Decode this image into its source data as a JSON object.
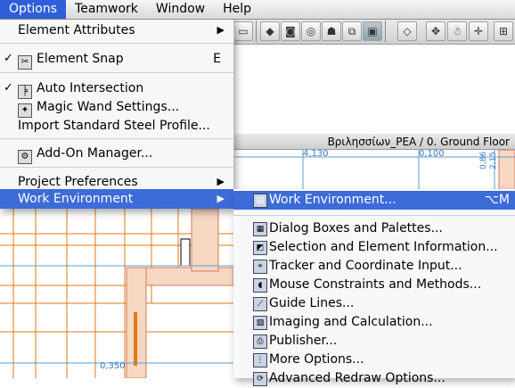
{
  "menubar": {
    "items": [
      "Options",
      "Teamwork",
      "Window",
      "Help"
    ],
    "active_index": 0
  },
  "window": {
    "title": "Βριλησσίων_PEA / 0. Ground Floor"
  },
  "plan": {
    "dimensions": [
      "4,130",
      "0,100",
      "0,350",
      "0,86",
      "2,15"
    ]
  },
  "menu": {
    "items": [
      {
        "label": "Element Attributes",
        "submenu": true
      },
      {
        "label": "Element Snap",
        "checked": true,
        "shortcut": "E",
        "icon": "snap-icon"
      },
      {
        "label": "Auto Intersection",
        "checked": true,
        "icon": "intersection-icon"
      },
      {
        "label": "Magic Wand Settings...",
        "icon": "magic-wand-icon"
      },
      {
        "label": "Import Standard Steel Profile..."
      },
      {
        "label": "Add-On Manager...",
        "icon": "addon-manager-icon"
      },
      {
        "label": "Project Preferences",
        "submenu": true
      },
      {
        "label": "Work Environment",
        "submenu": true,
        "highlighted": true
      }
    ],
    "check_mark": "✓",
    "arrow": "▶"
  },
  "submenu": {
    "items": [
      {
        "label": "Work Environment...",
        "shortcut": "⌥M",
        "highlighted": true,
        "icon": "work-environment-icon"
      },
      {
        "label": "Dialog Boxes and Palettes...",
        "icon": "dialog-boxes-icon"
      },
      {
        "label": "Selection and Element Information...",
        "icon": "selection-info-icon"
      },
      {
        "label": "Tracker and Coordinate Input...",
        "icon": "tracker-icon"
      },
      {
        "label": "Mouse Constraints and Methods...",
        "icon": "mouse-icon"
      },
      {
        "label": "Guide Lines...",
        "icon": "guide-lines-icon"
      },
      {
        "label": "Imaging and Calculation...",
        "icon": "imaging-icon"
      },
      {
        "label": "Publisher...",
        "icon": "publisher-icon"
      },
      {
        "label": "More Options...",
        "icon": "more-options-icon"
      },
      {
        "label": "Advanced Redraw Options...",
        "icon": "advanced-redraw-icon"
      }
    ]
  },
  "colors": {
    "highlight": "#3d6bd8",
    "plan_orange": "#e07a10",
    "plan_blue": "#5a9fd6"
  }
}
